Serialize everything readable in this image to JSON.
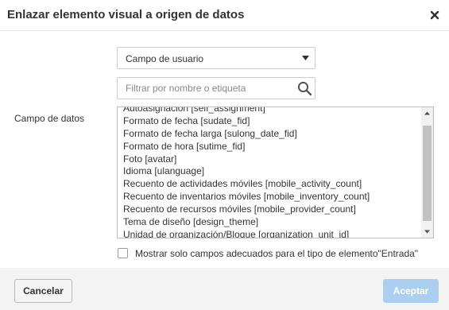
{
  "dialog": {
    "title": "Enlazar elemento visual a origen de datos",
    "close_icon": "close-icon"
  },
  "form": {
    "field_label": "Campo de datos",
    "source_select": {
      "selected": "Campo de usuario",
      "caret_icon": "caret-down-icon"
    },
    "filter": {
      "placeholder": "Filtrar por nombre o etiqueta",
      "value": "",
      "icon": "search-icon"
    },
    "fields": [
      "Autoasignación [self_assignment]",
      "Formato de fecha [sudate_fid]",
      "Formato de fecha larga [sulong_date_fid]",
      "Formato de hora [sutime_fid]",
      "Foto [avatar]",
      "Idioma [ulanguage]",
      "Recuento de actividades móviles [mobile_activity_count]",
      "Recuento de inventarios móviles [mobile_inventory_count]",
      "Recuento de recursos móviles [mobile_provider_count]",
      "Tema de diseño [design_theme]",
      "Unidad de organización/Bloque [organization_unit_id]"
    ],
    "scrollbar": {
      "up_icon": "scroll-up-arrow-icon",
      "down_icon": "scroll-down-arrow-icon"
    },
    "only_suitable_checkbox": {
      "label": "Mostrar solo campos adecuados para el tipo de elemento\"Entrada\"",
      "checked": false
    }
  },
  "footer": {
    "cancel_label": "Cancelar",
    "accept_label": "Aceptar",
    "accept_enabled": false
  },
  "colors": {
    "accent_disabled": "#abd0ef",
    "footer_bg": "#f3f3f3",
    "text": "#333333"
  }
}
